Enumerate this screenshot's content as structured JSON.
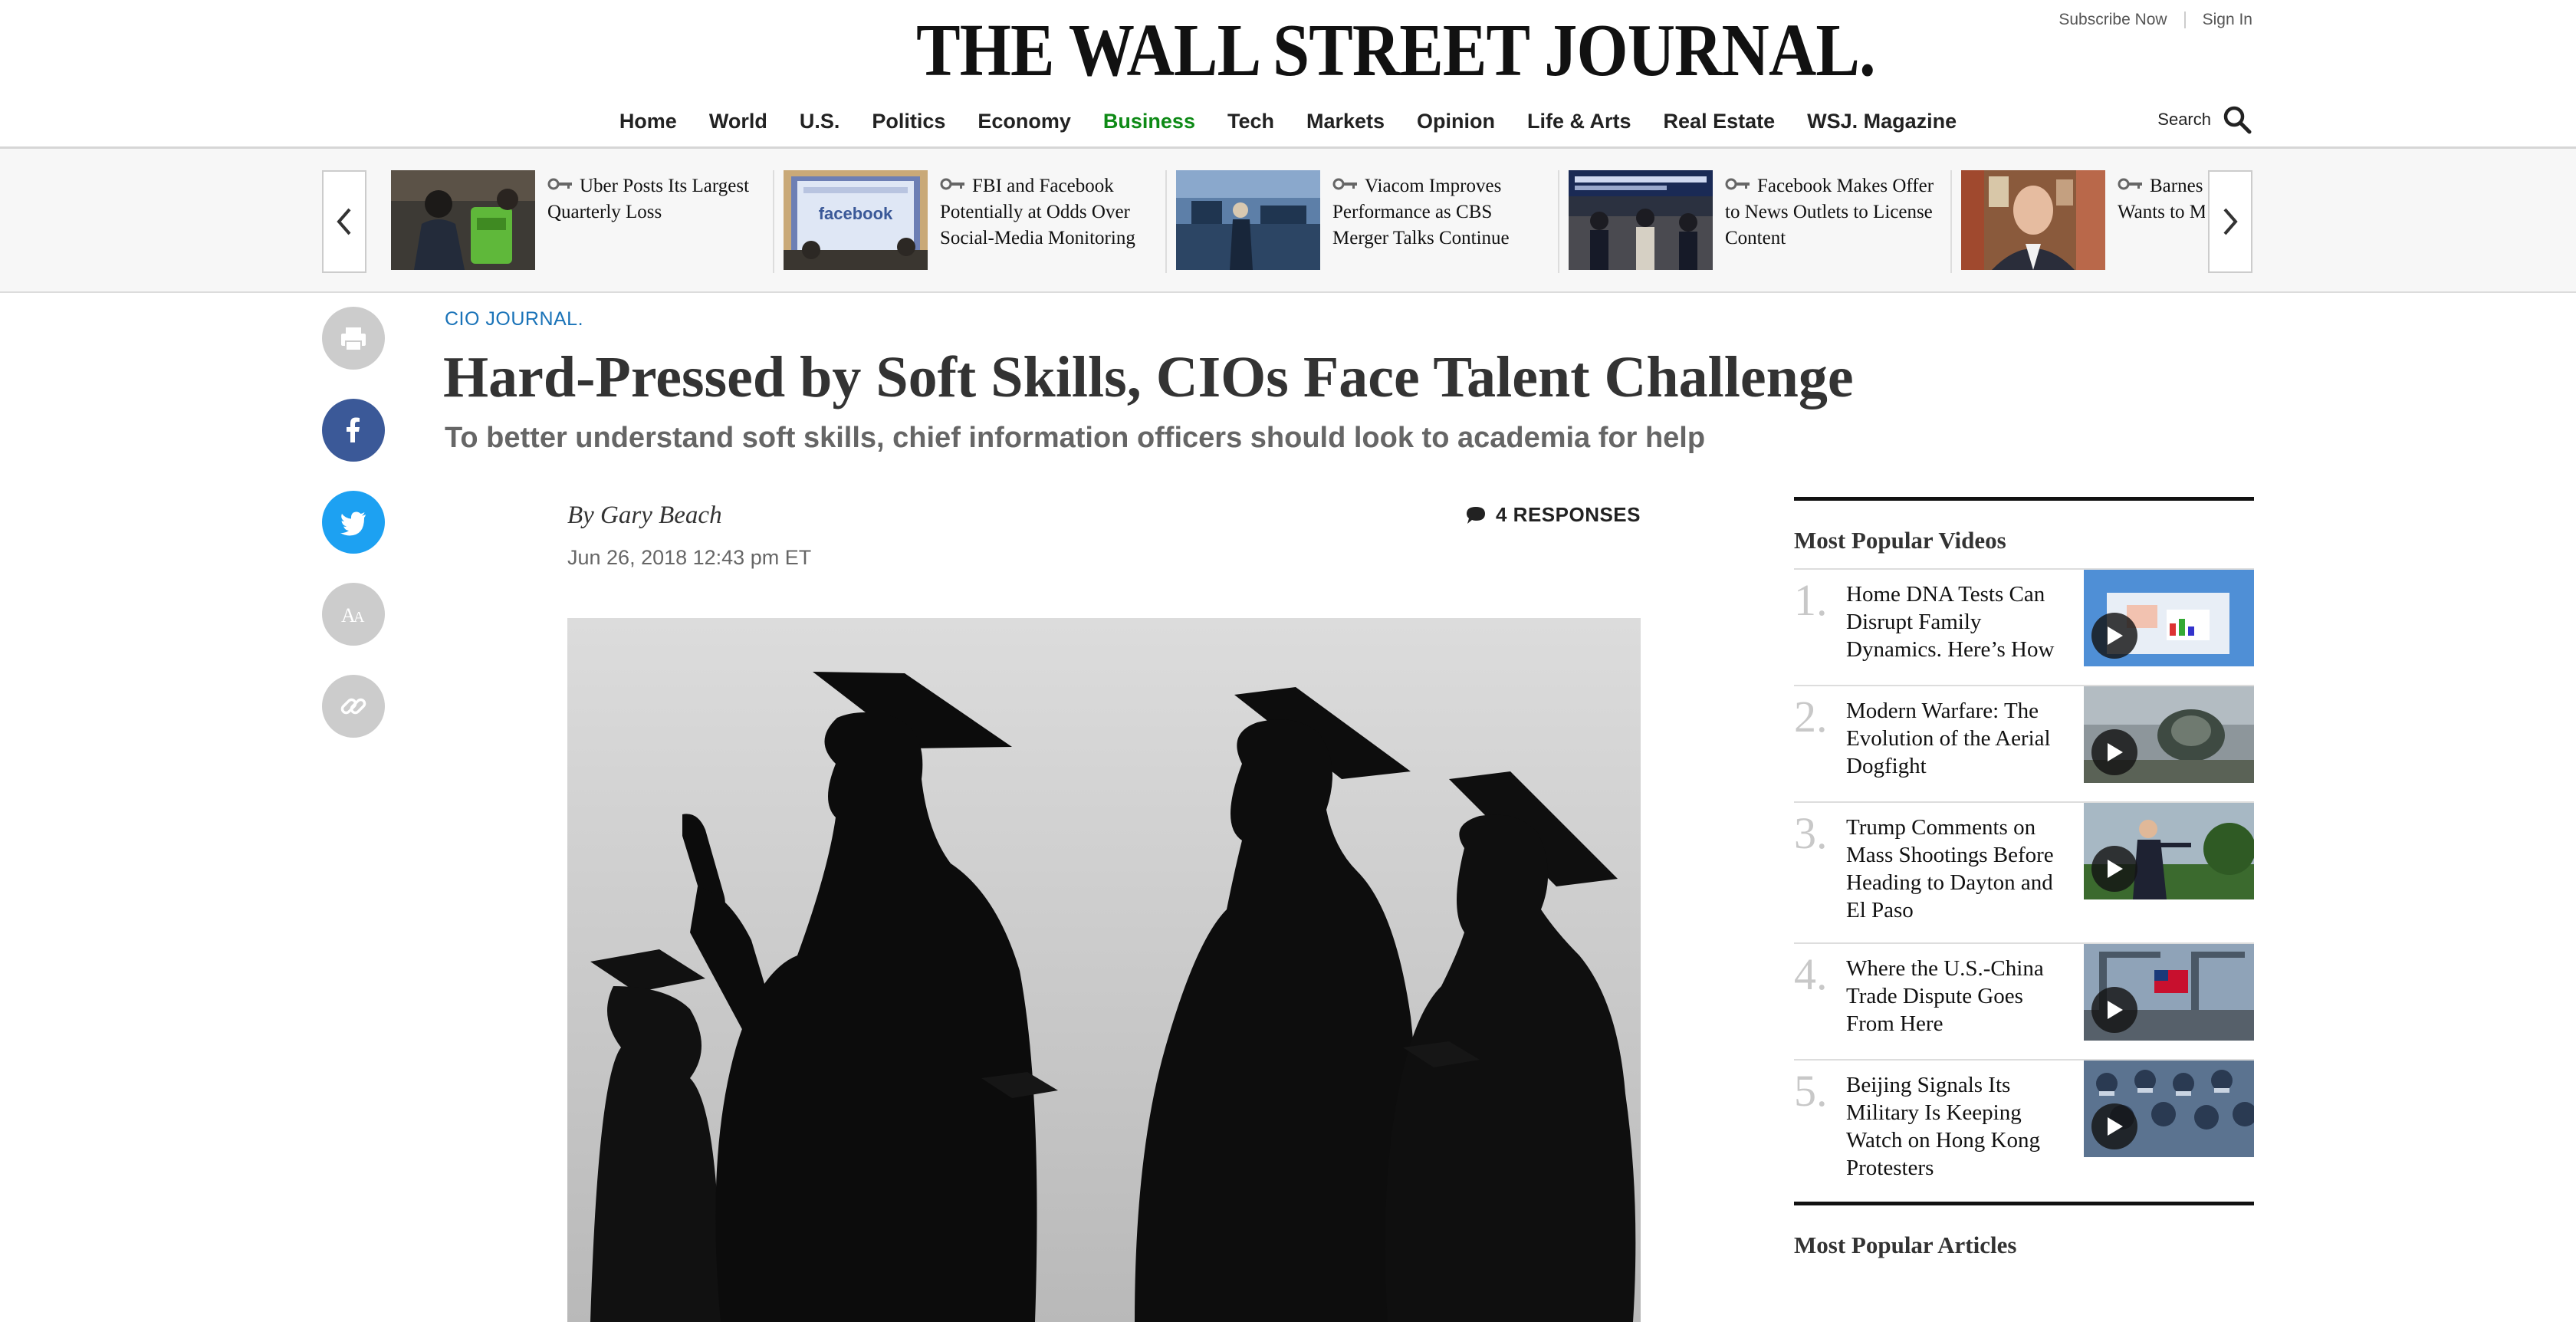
{
  "masthead": {
    "logo": "THE WALL STREET JOURNAL.",
    "subscribe": "Subscribe Now",
    "sign_in": "Sign In"
  },
  "nav": {
    "items": [
      "Home",
      "World",
      "U.S.",
      "Politics",
      "Economy",
      "Business",
      "Tech",
      "Markets",
      "Opinion",
      "Life & Arts",
      "Real Estate",
      "WSJ. Magazine"
    ],
    "active": "Business",
    "search_label": "Search"
  },
  "carousel": {
    "cards": [
      {
        "title": "Uber Posts Its Largest Quarterly Loss",
        "thumb": "uber-eats-photo"
      },
      {
        "title": "FBI and Facebook Potentially at Odds Over Social-Media Monitoring",
        "thumb": "facebook-hearing-photo"
      },
      {
        "title": "Viacom Improves Performance as CBS Merger Talks Continue",
        "thumb": "stock-exchange-photo"
      },
      {
        "title": "Facebook Makes Offer to News Outlets to License Content",
        "thumb": "newsroom-photo"
      },
      {
        "title": "Barnes & Noble CEO Wants to Make Your Local",
        "thumb": "ceo-portrait-photo"
      }
    ]
  },
  "share": {
    "icons": [
      "print-icon",
      "facebook-icon",
      "twitter-icon",
      "text-size-icon",
      "link-icon"
    ]
  },
  "article": {
    "kicker": "CIO JOURNAL.",
    "headline": "Hard-Pressed by Soft Skills, CIOs Face Talent Challenge",
    "dek": "To better understand soft skills, chief information officers should look to academia for help",
    "byline": "By Gary Beach",
    "timestamp": "Jun 26, 2018 12:43 pm ET",
    "responses": "4 RESPONSES"
  },
  "sidebar": {
    "videos_title": "Most Popular Videos",
    "videos": [
      {
        "num": "1.",
        "title": "Home DNA Tests Can Disrupt Family Dynamics. Here’s How"
      },
      {
        "num": "2.",
        "title": "Modern Warfare: The Evolution of the Aerial Dogfight"
      },
      {
        "num": "3.",
        "title": "Trump Comments on Mass Shootings Before Heading to Dayton and El Paso"
      },
      {
        "num": "4.",
        "title": "Where the U.S.-China Trade Dispute Goes From Here"
      },
      {
        "num": "5.",
        "title": "Beijing Signals Its Military Is Keeping Watch on Hong Kong Protesters"
      }
    ],
    "articles_title": "Most Popular Articles"
  },
  "colors": {
    "accent_business": "#0e8a16",
    "kicker_blue": "#1a73b8",
    "facebook": "#3b5998",
    "twitter": "#1da1f2",
    "rail_gray": "#cccccc"
  }
}
